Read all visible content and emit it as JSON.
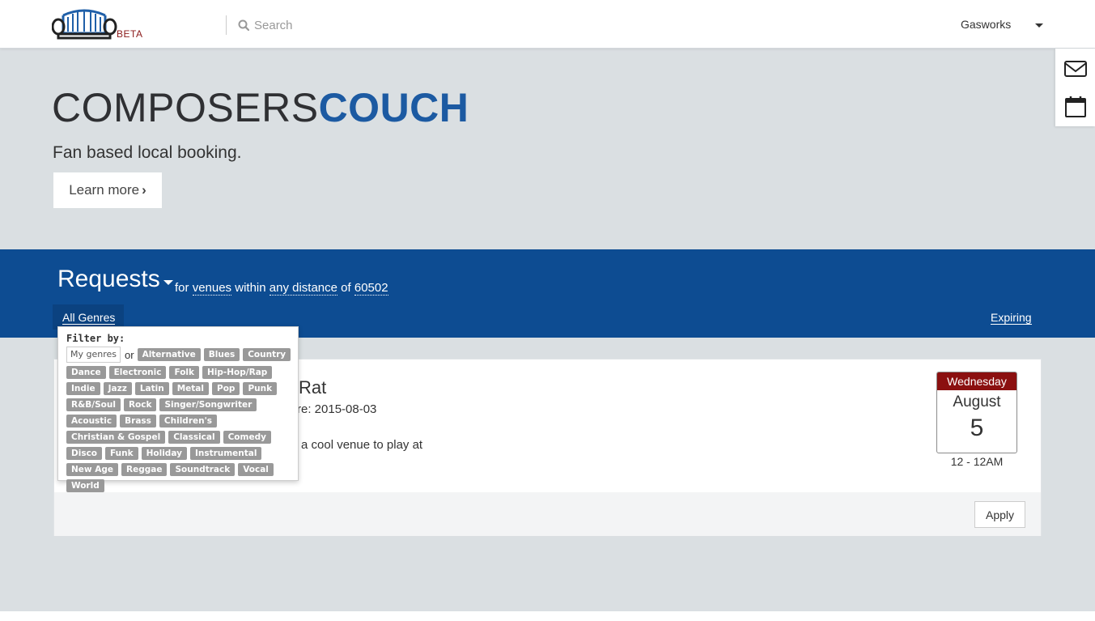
{
  "header": {
    "logo_badge": "BETA",
    "search_placeholder": "Search",
    "user_name": "Gasworks"
  },
  "hero": {
    "brand_part1": "COMPOSERS",
    "brand_part2": "COUCH",
    "tagline": "Fan based local booking.",
    "learn_more": "Learn more"
  },
  "side_icons": [
    "envelope-icon",
    "calendar-icon"
  ],
  "requests": {
    "title": "Requests",
    "for_word": "for",
    "target": "venues",
    "within_word": "within",
    "distance": "any distance",
    "of_word": "of",
    "zip": "60502",
    "genres_tab": "All Genres",
    "expiring": "Expiring"
  },
  "filter": {
    "label": "Filter by:",
    "my_genres": "My genres",
    "or": "or",
    "genres": [
      "Alternative",
      "Blues",
      "Country",
      "Dance",
      "Electronic",
      "Folk",
      "Hip-Hop/Rap",
      "Indie",
      "Jazz",
      "Latin",
      "Metal",
      "Pop",
      "Punk",
      "R&B/Soul",
      "Rock",
      "Singer/Songwriter",
      "Acoustic",
      "Brass",
      "Children's",
      "Christian & Gospel",
      "Classical",
      "Comedy",
      "Disco",
      "Funk",
      "Holiday",
      "Instrumental",
      "New Age",
      "Reggae",
      "Soundtrack",
      "Vocal",
      "World"
    ]
  },
  "card": {
    "title_visible": "Rat",
    "expire_visible": "re: 2015-08-03",
    "desc_visible": "a cool venue to play at",
    "weekday": "Wednesday",
    "month": "August",
    "day": "5",
    "time": "12 - 12AM",
    "apply": "Apply"
  },
  "colors": {
    "brand_blue": "#1c5aa2",
    "requests_bar": "#0d4c92",
    "calendar_red": "#8b1010",
    "hero_bg": "#dadfe2"
  }
}
